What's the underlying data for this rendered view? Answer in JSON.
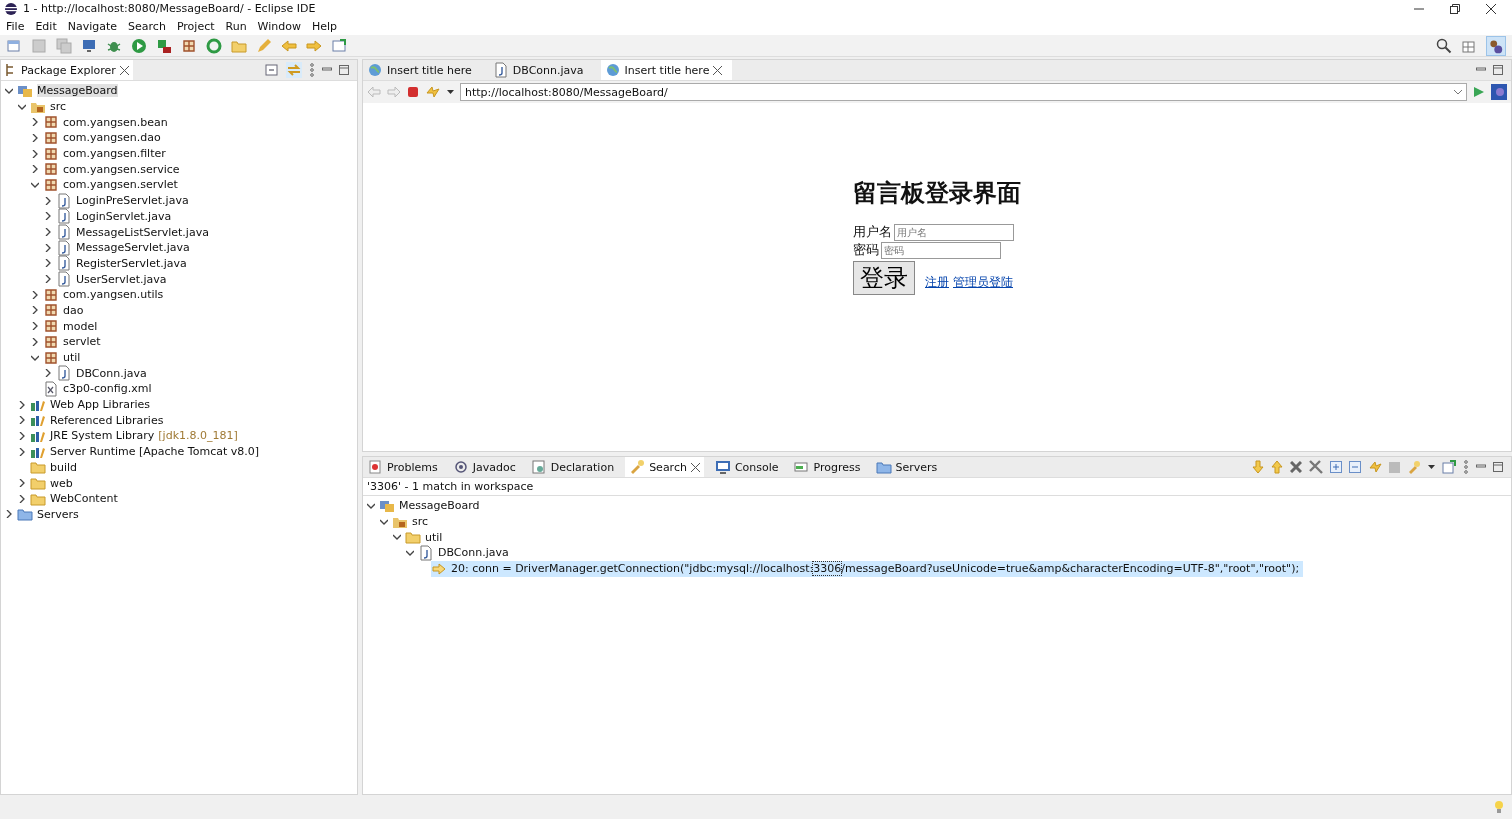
{
  "window": {
    "title": "1 - http://localhost:8080/MessageBoard/ - Eclipse IDE"
  },
  "menu": [
    "File",
    "Edit",
    "Navigate",
    "Search",
    "Project",
    "Run",
    "Window",
    "Help"
  ],
  "package_explorer": {
    "title": "Package Explorer",
    "tree": [
      {
        "label": "MessageBoard",
        "kind": "project",
        "expanded": true,
        "selected": true,
        "children": [
          {
            "label": "src",
            "kind": "src",
            "expanded": true,
            "selected": false,
            "children": [
              {
                "label": "com.yangsen.bean",
                "kind": "package",
                "expanded": false,
                "selected": false
              },
              {
                "label": "com.yangsen.dao",
                "kind": "package",
                "expanded": false,
                "selected": false
              },
              {
                "label": "com.yangsen.filter",
                "kind": "package",
                "expanded": false,
                "selected": false
              },
              {
                "label": "com.yangsen.service",
                "kind": "package",
                "expanded": false,
                "selected": false
              },
              {
                "label": "com.yangsen.servlet",
                "kind": "package",
                "expanded": true,
                "selected": false,
                "children": [
                  {
                    "label": "LoginPreServlet.java",
                    "kind": "java",
                    "expanded": false,
                    "selected": false
                  },
                  {
                    "label": "LoginServlet.java",
                    "kind": "java",
                    "expanded": false,
                    "selected": false
                  },
                  {
                    "label": "MessageListServlet.java",
                    "kind": "java",
                    "expanded": false,
                    "selected": false
                  },
                  {
                    "label": "MessageServlet.java",
                    "kind": "java",
                    "expanded": false,
                    "selected": false
                  },
                  {
                    "label": "RegisterServlet.java",
                    "kind": "java",
                    "expanded": false,
                    "selected": false
                  },
                  {
                    "label": "UserServlet.java",
                    "kind": "java",
                    "expanded": false,
                    "selected": false
                  }
                ]
              },
              {
                "label": "com.yangsen.utils",
                "kind": "package",
                "expanded": false,
                "selected": false
              },
              {
                "label": "dao",
                "kind": "package",
                "expanded": false,
                "selected": false
              },
              {
                "label": "model",
                "kind": "package",
                "expanded": false,
                "selected": false
              },
              {
                "label": "servlet",
                "kind": "package",
                "expanded": false,
                "selected": false
              },
              {
                "label": "util",
                "kind": "package",
                "expanded": true,
                "selected": false,
                "children": [
                  {
                    "label": "DBConn.java",
                    "kind": "java",
                    "expanded": false,
                    "selected": false
                  }
                ]
              },
              {
                "label": "c3p0-config.xml",
                "kind": "xml",
                "selected": false
              }
            ]
          },
          {
            "label": "Web App Libraries",
            "kind": "library",
            "expanded": false,
            "selected": false
          },
          {
            "label": "Referenced Libraries",
            "kind": "library",
            "expanded": false,
            "selected": false
          },
          {
            "label": "JRE System Library",
            "decoration": "[jdk1.8.0_181]",
            "kind": "library",
            "expanded": false,
            "selected": false
          },
          {
            "label": "Server Runtime [Apache Tomcat v8.0]",
            "kind": "library",
            "expanded": false,
            "selected": false
          },
          {
            "label": "build",
            "kind": "folder",
            "selected": false
          },
          {
            "label": "web",
            "kind": "folder",
            "expanded": false,
            "selected": false
          },
          {
            "label": "WebContent",
            "kind": "folder",
            "expanded": false,
            "selected": false
          }
        ]
      },
      {
        "label": "Servers",
        "kind": "servers",
        "expanded": false,
        "selected": false
      }
    ]
  },
  "editor_tabs": [
    {
      "label": "Insert title here",
      "kind": "web",
      "selected": false
    },
    {
      "label": "DBConn.java",
      "kind": "java",
      "selected": false
    },
    {
      "label": "Insert title here",
      "kind": "web",
      "selected": true
    }
  ],
  "browser": {
    "url": "http://localhost:8080/MessageBoard/",
    "page": {
      "heading": "留言板登录界面",
      "username_label": "用户名",
      "username_placeholder": "用户名",
      "password_label": "密码",
      "password_placeholder": "密码",
      "login_button": "登录",
      "links": [
        "注册",
        "管理员登陆"
      ]
    }
  },
  "bottom_tabs": [
    {
      "label": "Problems",
      "kind": "problems",
      "selected": false
    },
    {
      "label": "Javadoc",
      "kind": "javadoc",
      "selected": false
    },
    {
      "label": "Declaration",
      "kind": "declaration",
      "selected": false
    },
    {
      "label": "Search",
      "kind": "search",
      "selected": true
    },
    {
      "label": "Console",
      "kind": "console",
      "selected": false
    },
    {
      "label": "Progress",
      "kind": "progress",
      "selected": false
    },
    {
      "label": "Servers",
      "kind": "servers",
      "selected": false
    }
  ],
  "search": {
    "summary": "'3306' - 1 match in workspace",
    "results": [
      {
        "label": "MessageBoard",
        "kind": "project",
        "expanded": true,
        "selected": false,
        "children": [
          {
            "label": "src",
            "kind": "src",
            "expanded": true,
            "selected": false,
            "children": [
              {
                "label": "util",
                "kind": "folder",
                "expanded": true,
                "selected": false,
                "children": [
                  {
                    "label": "DBConn.java",
                    "kind": "java",
                    "expanded": true,
                    "selected": false,
                    "children": [
                      {
                        "kind": "match",
                        "selected": true,
                        "before": "20: conn = DriverManager.getConnection(\"jdbc:mysql://localhost:",
                        "match": "3306",
                        "after": "/messageBoard?useUnicode=true&amp&characterEncoding=UTF-8\",\"root\",\"root\");"
                      }
                    ]
                  }
                ]
              }
            ]
          }
        ]
      }
    ]
  }
}
